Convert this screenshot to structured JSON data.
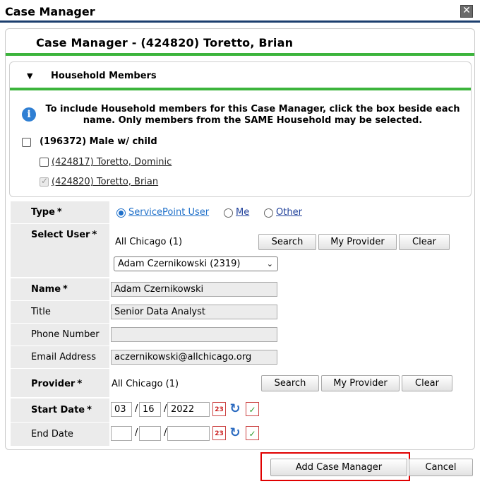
{
  "window": {
    "title": "Case Manager",
    "close_glyph": "✕"
  },
  "header": {
    "title": "Case Manager - (424820) Toretto, Brian"
  },
  "household": {
    "section_title": "Household Members",
    "info_text": "To include Household members for this Case Manager, click the box beside each name. Only members from the SAME Household may be selected.",
    "group_label": "(196372) Male w/ child",
    "members": [
      {
        "label": "(424817) Toretto, Dominic",
        "checked": false
      },
      {
        "label": "(424820) Toretto, Brian",
        "checked": true
      }
    ]
  },
  "form": {
    "type": {
      "label": "Type",
      "required": "*",
      "options": [
        "ServicePoint User",
        "Me",
        "Other"
      ],
      "selected": "ServicePoint User"
    },
    "select_user": {
      "label": "Select User",
      "required": "*",
      "provider_text": "All Chicago (1)",
      "buttons": [
        "Search",
        "My Provider",
        "Clear"
      ],
      "selected_value": "Adam Czernikowski (2319)"
    },
    "name": {
      "label": "Name",
      "required": "*",
      "value": "Adam Czernikowski"
    },
    "title": {
      "label": "Title",
      "value": "Senior Data Analyst"
    },
    "phone": {
      "label": "Phone Number",
      "value": ""
    },
    "email": {
      "label": "Email Address",
      "value": "aczernikowski@allchicago.org"
    },
    "provider": {
      "label": "Provider",
      "required": "*",
      "value": "All Chicago (1)",
      "buttons": [
        "Search",
        "My Provider",
        "Clear"
      ]
    },
    "start_date": {
      "label": "Start Date",
      "required": "*",
      "month": "03",
      "day": "16",
      "year": "2022",
      "sep": "/"
    },
    "end_date": {
      "label": "End Date",
      "month": "",
      "day": "",
      "year": "",
      "sep": "/"
    }
  },
  "footer": {
    "add_label": "Add Case Manager",
    "cancel_label": "Cancel"
  },
  "icons": {
    "calendar": "23",
    "refresh": "↻",
    "calendar_check": "✓",
    "info": "i",
    "expand": "▼",
    "chevron": "⌄"
  },
  "colors": {
    "accent_green": "#3cb43c",
    "title_rule": "#1c3f6e",
    "radio_blue": "#1e6fc9",
    "highlight_red": "#e00000"
  }
}
